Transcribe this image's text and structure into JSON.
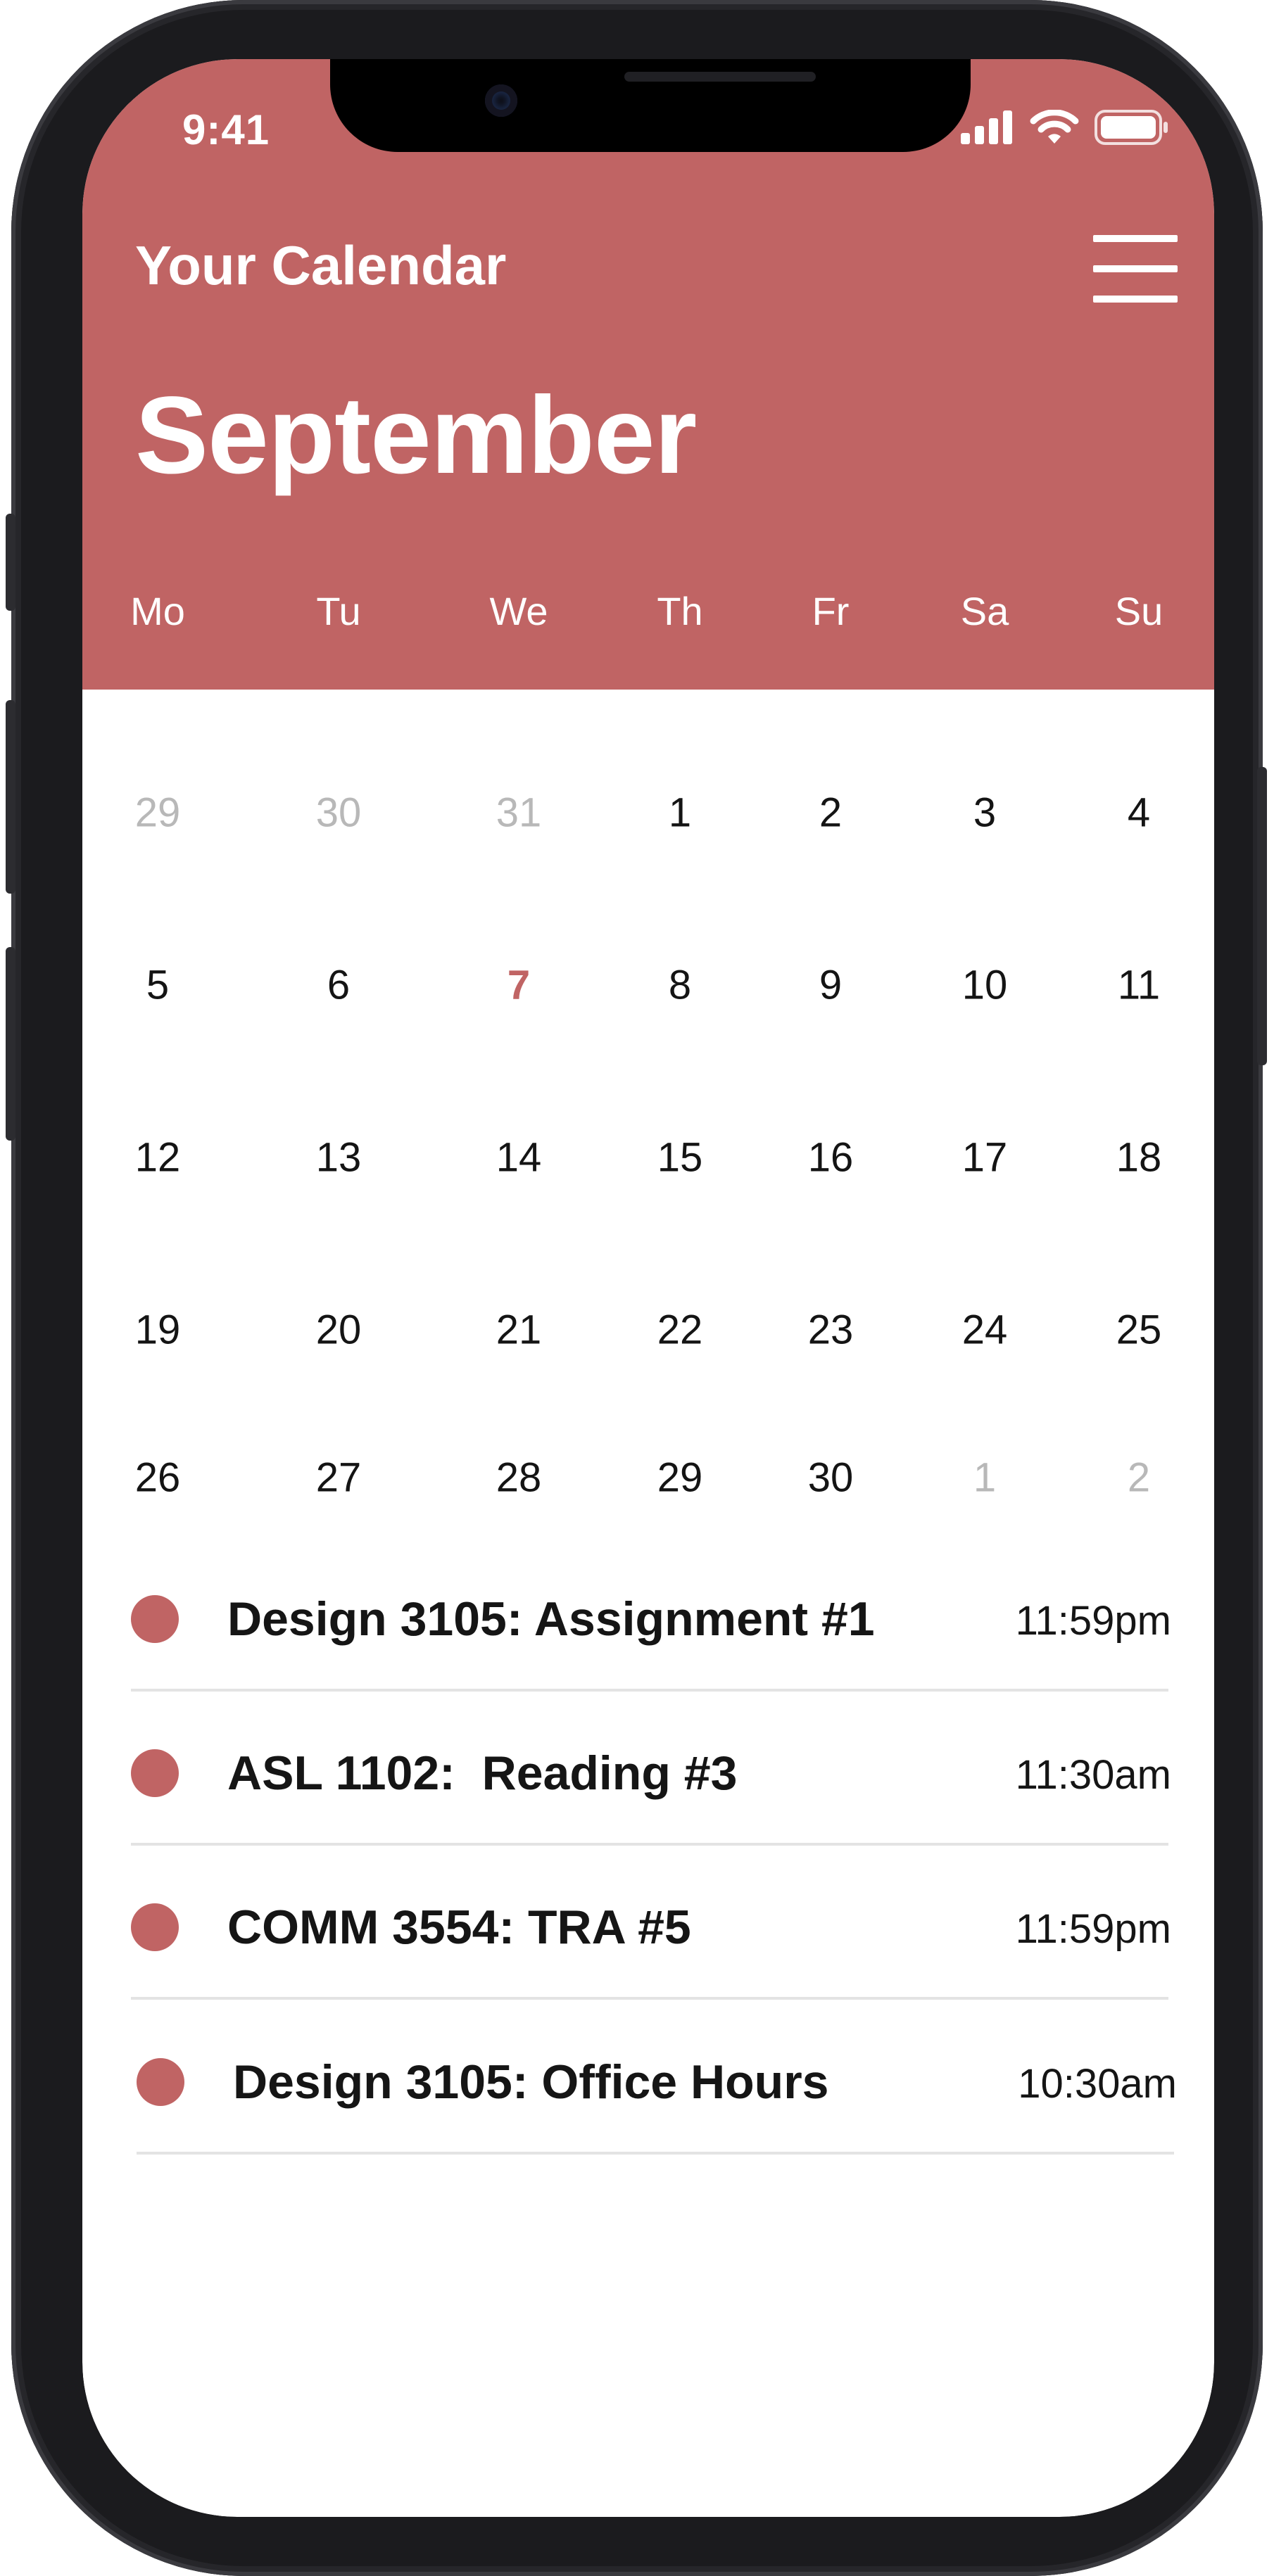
{
  "status_bar": {
    "time": "9:41"
  },
  "header": {
    "app_title": "Your Calendar",
    "month": "September",
    "weekdays": [
      "Mo",
      "Tu",
      "We",
      "Th",
      "Fr",
      "Sa",
      "Su"
    ]
  },
  "calendar": {
    "weeks": [
      [
        {
          "d": "29",
          "state": "other"
        },
        {
          "d": "30",
          "state": "other"
        },
        {
          "d": "31",
          "state": "other"
        },
        {
          "d": "1",
          "state": "current"
        },
        {
          "d": "2",
          "state": "current"
        },
        {
          "d": "3",
          "state": "current"
        },
        {
          "d": "4",
          "state": "current"
        }
      ],
      [
        {
          "d": "5",
          "state": "current"
        },
        {
          "d": "6",
          "state": "current"
        },
        {
          "d": "7",
          "state": "today"
        },
        {
          "d": "8",
          "state": "current"
        },
        {
          "d": "9",
          "state": "current"
        },
        {
          "d": "10",
          "state": "current"
        },
        {
          "d": "11",
          "state": "current"
        }
      ],
      [
        {
          "d": "12",
          "state": "current"
        },
        {
          "d": "13",
          "state": "current"
        },
        {
          "d": "14",
          "state": "current"
        },
        {
          "d": "15",
          "state": "current"
        },
        {
          "d": "16",
          "state": "current"
        },
        {
          "d": "17",
          "state": "current"
        },
        {
          "d": "18",
          "state": "current"
        }
      ],
      [
        {
          "d": "19",
          "state": "current"
        },
        {
          "d": "20",
          "state": "current"
        },
        {
          "d": "21",
          "state": "current"
        },
        {
          "d": "22",
          "state": "current"
        },
        {
          "d": "23",
          "state": "current"
        },
        {
          "d": "24",
          "state": "current"
        },
        {
          "d": "25",
          "state": "current"
        }
      ],
      [
        {
          "d": "26",
          "state": "current"
        },
        {
          "d": "27",
          "state": "current"
        },
        {
          "d": "28",
          "state": "current"
        },
        {
          "d": "29",
          "state": "current"
        },
        {
          "d": "30",
          "state": "current"
        },
        {
          "d": "1",
          "state": "other"
        },
        {
          "d": "2",
          "state": "other"
        }
      ]
    ]
  },
  "events": [
    {
      "title": "Design 3105: Assignment #1",
      "time": "11:59pm"
    },
    {
      "title": "ASL 1102:  Reading #3",
      "time": "11:30am"
    },
    {
      "title": "COMM 3554: TRA #5",
      "time": "11:59pm"
    },
    {
      "title": "Design 3105: Office Hours",
      "time": "10:30am"
    }
  ],
  "colors": {
    "accent": "#c06464",
    "text": "#151515",
    "muted": "#b8b8b8",
    "divider": "#e3e3e3"
  },
  "icons": [
    "signal-icon",
    "wifi-icon",
    "battery-icon",
    "menu-icon",
    "camera-icon"
  ]
}
